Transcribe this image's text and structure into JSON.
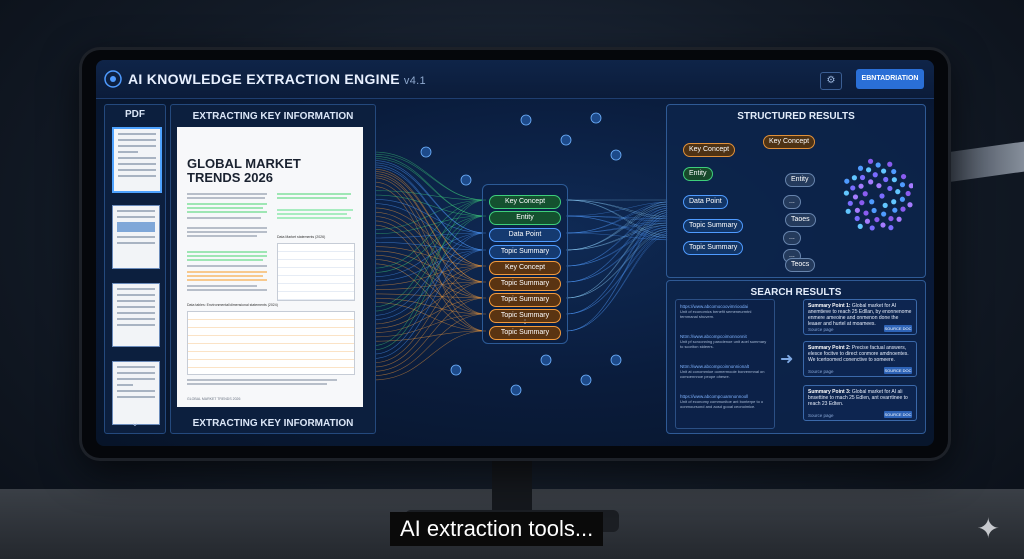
{
  "app": {
    "title": "AI KNOWLEDGE EXTRACTION ENGINE",
    "version": "v4.1",
    "action_button": "EBNTADRIATION",
    "settings_icon": "gear-icon"
  },
  "pdf_panel": {
    "label": "PDF",
    "nav_icon": "chevron-down-icon"
  },
  "document_panel": {
    "header": "EXTRACTING KEY INFORMATION",
    "footer": "EXTRACTING KEY INFORMATION",
    "doc_title": "GLOBAL MARKET TRENDS 2026",
    "doc_footer": "GLOBAL MARKET TRENDS 2026",
    "table_caption": "Data tables: Environmental/dimensional statements (2024)",
    "table2_caption": "Data Market statements (2026)"
  },
  "extraction_tags": [
    {
      "label": "Key Concept",
      "kind": "g"
    },
    {
      "label": "Entity",
      "kind": "g"
    },
    {
      "label": "Data Point",
      "kind": "b"
    },
    {
      "label": "Topic Summary",
      "kind": "b"
    },
    {
      "label": "Key Concept",
      "kind": "o"
    },
    {
      "label": "Topic Summary",
      "kind": "o"
    },
    {
      "label": "Topic Summary",
      "kind": "o"
    },
    {
      "label": "Topic Summary",
      "kind": "o"
    },
    {
      "label": "Topic Summary",
      "kind": "o"
    }
  ],
  "extraction_tags_more": "⋮",
  "structured_results": {
    "title": "STRUCTURED RESULTS",
    "left_nodes": [
      "Key Concept",
      "Entity",
      "Data Point",
      "Topic Summary",
      "Topic Summary"
    ],
    "right_nodes": [
      "Key Concept",
      "Entity",
      "...",
      "Taoes",
      "...",
      "...",
      "Teocs"
    ]
  },
  "search_results": {
    "title": "SEARCH RESULTS",
    "snippets": [
      {
        "url": "https://www.abcomocoovimrioodai",
        "text": "Unit of economics benefit semeneurmtnl ternmanal shuvern."
      },
      {
        "url": "Nttm://www.abcompcoimonnonnit",
        "text": "Unit pf scroonning parodenoe unit aoel summary to scoriton stdeers."
      },
      {
        "url": "Nttm://www.abcompcoinnonnionalt",
        "text": "Unit at conommioe oomermooie bonrenmnal on comoennnoe peope ohesre."
      },
      {
        "url": "https://www.abcompcuamnonnooll",
        "text": "Unit of economy communitoe ant bonterpe to o oonmoursond and aosd gooal ceonoimice."
      }
    ],
    "arrow_icon": "arrow-right-icon",
    "summaries": [
      {
        "head": "Summary Point 1:",
        "text": "Global market for AI anemtieve to reach 25 Edllan, by enonnenome enmere ameoine and onmenon done the leaaer and hurtel at moamees.",
        "page": "Source page",
        "button": "SOURCE DOC"
      },
      {
        "head": "Summary Point 2:",
        "text": "Precise factual answers, elesce focitve to direct conmore amdnoentes. We tcertoomed conenctive to someere.",
        "page": "Source page",
        "button": "SOURCE DOC"
      },
      {
        "head": "Summary Point 3:",
        "text": "Global market for AI ali bnsettine to rnach 25 Edlen, ant ovarrtinee to reach 23 Edten.",
        "page": "Source page",
        "button": "SOURCE DOC"
      }
    ]
  },
  "caption": "AI extraction tools...",
  "colors": {
    "accent": "#2a6fd6",
    "green": "#3ecf7b",
    "blue": "#4f9bff",
    "orange": "#f29a3b",
    "screen_bg": "#0a1c3c"
  }
}
